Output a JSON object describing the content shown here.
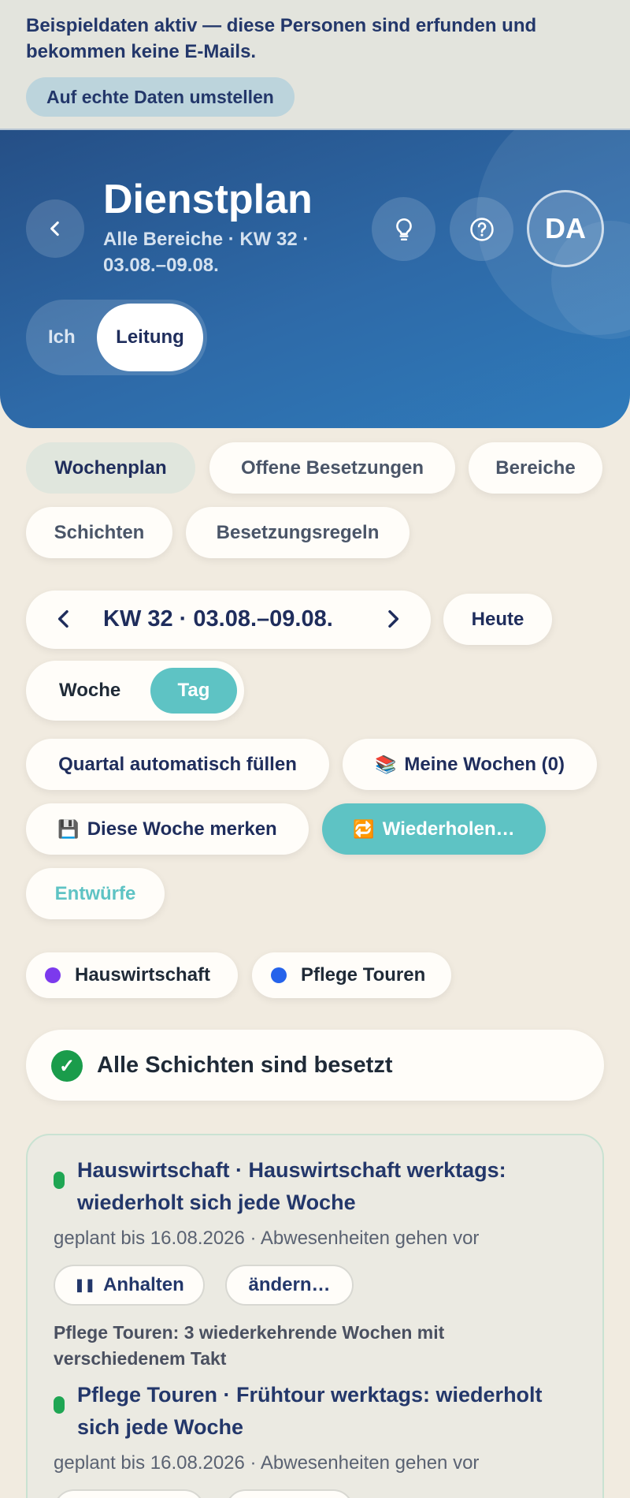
{
  "banner": {
    "text": "Beispieldaten aktiv — diese Personen sind erfunden und bekommen keine E-Mails.",
    "button": "Auf echte Daten umstellen"
  },
  "header": {
    "title": "Dienstplan",
    "subtitle": "Alle Bereiche · KW 32 · 03.08.–09.08.",
    "avatar": "DA",
    "role_options": [
      "Ich",
      "Leitung"
    ],
    "role_selected": "Leitung"
  },
  "tabs": [
    "Wochenplan",
    "Offene Besetzungen",
    "Bereiche",
    "Schichten",
    "Besetzungsregeln"
  ],
  "tabs_active": "Wochenplan",
  "week_nav": {
    "label": "KW 32 · 03.08.–09.08.",
    "today": "Heute"
  },
  "view_toggle": {
    "woche": "Woche",
    "tag": "Tag",
    "selected": "Tag"
  },
  "actions": {
    "fill_quarter": "Quartal automatisch füllen",
    "my_weeks": "Meine Wochen (0)",
    "save_week": "Diese Woche merken",
    "repeat": "Wiederholen…",
    "drafts": "Entwürfe"
  },
  "areas": [
    {
      "label": "Hauswirtschaft",
      "color": "#7c3aed"
    },
    {
      "label": "Pflege Touren",
      "color": "#2563eb"
    }
  ],
  "status": {
    "text": "Alle Schichten sind besetzt"
  },
  "recurring": {
    "items": [
      {
        "title": "Hauswirtschaft · Hauswirtschaft werktags: wiederholt sich jede Woche",
        "sub": "geplant bis 16.08.2026 · Abwesenheiten gehen vor",
        "pause": "Anhalten",
        "edit": "ändern…"
      },
      {
        "title": "Pflege Touren · Frühtour werktags: wiederholt sich jede Woche",
        "sub": "geplant bis 16.08.2026 · Abwesenheiten gehen vor"
      }
    ],
    "note": "Pflege Touren: 3 wiederkehrende Wochen mit verschiedenem Takt"
  }
}
